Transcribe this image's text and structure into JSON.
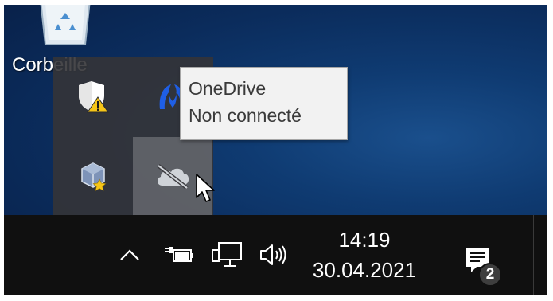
{
  "desktop": {
    "recycle_bin_label": "Corbeille"
  },
  "tray_overflow": {
    "icons": [
      {
        "name": "windows-security-warning-icon"
      },
      {
        "name": "malwarebytes-icon"
      },
      {
        "name": "virtualbox-icon"
      },
      {
        "name": "onedrive-disconnected-icon"
      }
    ]
  },
  "tooltip": {
    "title": "OneDrive",
    "status": "Non connecté"
  },
  "taskbar": {
    "show_hidden_icons": "chevron-up-icon",
    "power_icon": "battery-plug-icon",
    "network_icon": "network-monitor-icon",
    "volume_icon": "speaker-icon",
    "time": "14:19",
    "date": "30.04.2021",
    "notifications_icon": "action-center-icon",
    "notification_count": "2"
  },
  "colors": {
    "desktop_bg": "#0b2c5c",
    "taskbar_bg": "#101010",
    "tooltip_bg": "#f2f2f2",
    "warning_yellow": "#f5c518",
    "malwarebytes_blue": "#1f5fe6"
  }
}
